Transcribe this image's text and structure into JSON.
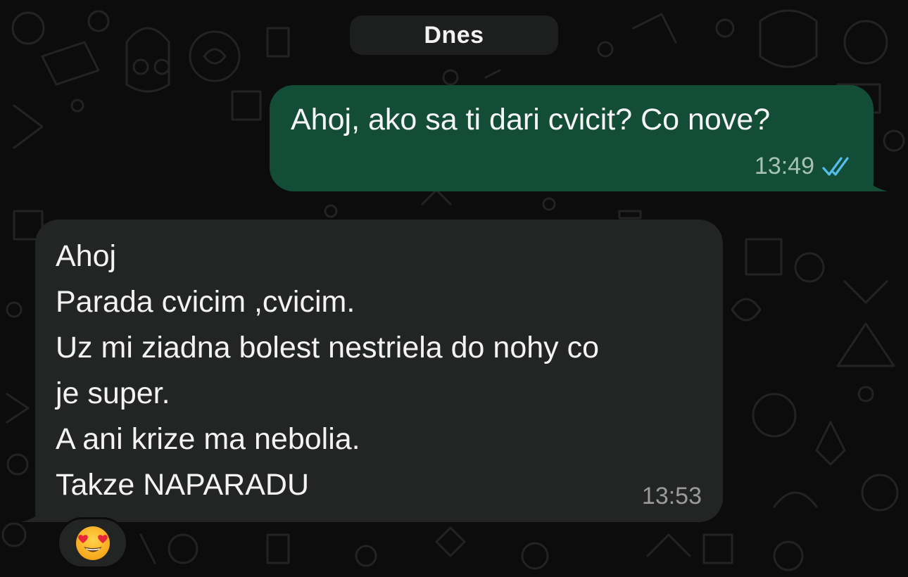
{
  "date_separator": {
    "label": "Dnes"
  },
  "messages": [
    {
      "direction": "outgoing",
      "text": "Ahoj, ako sa ti dari cvicit? Co nove?",
      "time": "13:49",
      "status_icon": "double-check-read-icon"
    },
    {
      "direction": "incoming",
      "lines": [
        "Ahoj",
        "Parada cvicim ,cvicim.",
        "Uz mi ziadna bolest nestriela do nohy co",
        "je super.",
        "A ani krize ma nebolia.",
        "Takze NAPARADU"
      ],
      "time": "13:53",
      "reaction": {
        "emoji": "😍",
        "icon": "heart-eyes-emoji-icon"
      }
    }
  ],
  "colors": {
    "background": "#0c0c0c",
    "outgoing_bubble": "#134d37",
    "incoming_bubble": "#232424",
    "read_ticks": "#53bdeb"
  }
}
